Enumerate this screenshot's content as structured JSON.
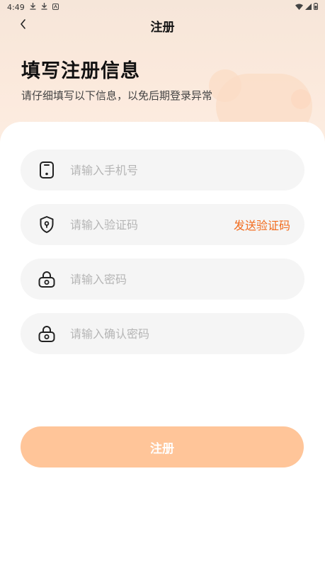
{
  "status_bar": {
    "time": "4:49"
  },
  "nav": {
    "title": "注册"
  },
  "header": {
    "title": "填写注册信息",
    "subtitle": "请仔细填写以下信息，以免后期登录异常"
  },
  "form": {
    "phone": {
      "placeholder": "请输入手机号",
      "value": ""
    },
    "code": {
      "placeholder": "请输入验证码",
      "value": "",
      "send_label": "发送验证码"
    },
    "password": {
      "placeholder": "请输入密码",
      "value": ""
    },
    "confirm_password": {
      "placeholder": "请输入确认密码",
      "value": ""
    }
  },
  "submit_label": "注册",
  "colors": {
    "accent": "#f26b1d",
    "button": "#ffc599",
    "field_bg": "#f5f5f5"
  },
  "icons": [
    "download-icon",
    "download-icon",
    "notification-icon",
    "wifi-icon",
    "signal-icon",
    "battery-icon",
    "back-chevron-icon",
    "phone-icon",
    "shield-icon",
    "lock-icon",
    "lock-icon"
  ]
}
